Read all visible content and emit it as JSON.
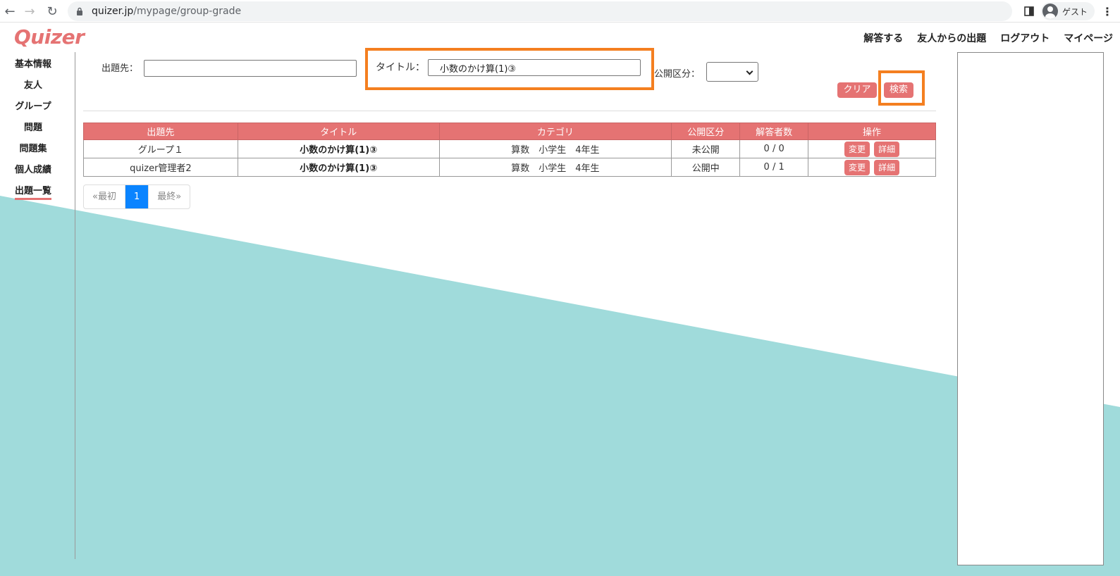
{
  "browser": {
    "url_host": "quizer.jp",
    "url_path": "/mypage/group-grade",
    "profile_label": "ゲスト"
  },
  "header": {
    "logo": "Quizer",
    "nav": [
      "解答する",
      "友人からの出題",
      "ログアウト",
      "マイページ"
    ]
  },
  "sidebar": {
    "items": [
      {
        "label": "基本情報",
        "active": false
      },
      {
        "label": "友人",
        "active": false
      },
      {
        "label": "グループ",
        "active": false
      },
      {
        "label": "問題",
        "active": false
      },
      {
        "label": "問題集",
        "active": false
      },
      {
        "label": "個人成績",
        "active": false
      },
      {
        "label": "出題一覧",
        "active": true
      }
    ]
  },
  "filter": {
    "target_label": "出題先：",
    "target_value": "",
    "title_label": "タイトル：",
    "title_value": "小数のかけ算(1)③",
    "visibility_label": "公開区分：",
    "visibility_value": "",
    "clear_label": "クリア",
    "search_label": "検索"
  },
  "table": {
    "headers": [
      "出題先",
      "タイトル",
      "カテゴリ",
      "公開区分",
      "解答者数",
      "操作"
    ],
    "rows": [
      {
        "target": "グループ１",
        "title": "小数のかけ算(1)③",
        "category": "算数　小学生　4年生",
        "visibility": "未公開",
        "answers": "0 / 0",
        "edit": "変更",
        "detail": "詳細"
      },
      {
        "target": "quizer管理者2",
        "title": "小数のかけ算(1)③",
        "category": "算数　小学生　4年生",
        "visibility": "公開中",
        "answers": "0 / 1",
        "edit": "変更",
        "detail": "詳細"
      }
    ]
  },
  "pager": {
    "first": "«最初",
    "current": "1",
    "last": "最終»"
  },
  "colors": {
    "accent": "#e57373",
    "teal": "#a0dbdb",
    "highlight": "#f47f20",
    "page_active": "#0a84ff"
  }
}
